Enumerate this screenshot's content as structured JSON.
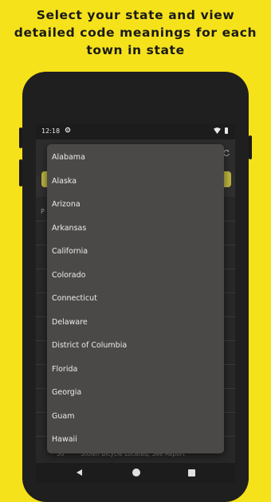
{
  "headline": {
    "line1": "Select your state and view",
    "line2": "detailed code meanings for each",
    "line3": "town in state"
  },
  "status_bar": {
    "time": "12:18"
  },
  "content": {
    "header_letter": "P"
  },
  "background_row": {
    "number": "30",
    "text": "Stolen Bicycle Located, See Report"
  },
  "state_menu": {
    "items": [
      "Alabama",
      "Alaska",
      "Arizona",
      "Arkansas",
      "California",
      "Colorado",
      "Connecticut",
      "Delaware",
      "District of Columbia",
      "Florida",
      "Georgia",
      "Guam",
      "Hawaii"
    ]
  },
  "colors": {
    "background": "#f5e21b",
    "phone_body": "#1f1f1f",
    "menu_surface": "#4b4948",
    "select_bar": "#bdb441",
    "menu_text": "#ececec"
  },
  "icons": [
    "gear-icon",
    "wifi-icon",
    "battery-icon",
    "refresh-icon",
    "back-icon",
    "home-icon",
    "recents-icon"
  ]
}
